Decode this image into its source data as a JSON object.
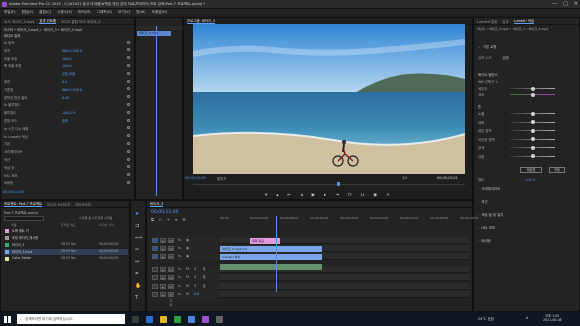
{
  "window": {
    "title": "Adobe Premiere Pro CC 2019 - C:\\#2021 광고 아이템\\#학습 영상 강의 자료\\프리미어 프로 강좌\\Part.7 프로젝트.prproj *",
    "controls": [
      "—",
      "□",
      "✕"
    ]
  },
  "menu": [
    "파일(F)",
    "편집(E)",
    "클립(C)",
    "시퀀스(S)",
    "마커(M)",
    "그래픽(G)",
    "보기(V)",
    "창(W)",
    "도움말(H)"
  ],
  "effect_controls": {
    "tabs": [
      "소스: 바이크_3.mp4",
      "효과 컨트롤",
      "오디오 클립 믹서: 바이크_3",
      "메타데이터"
    ],
    "header": "마스터 • 바이크_3.mp4  〉 바이크_3 • 바이크_3.mp4",
    "section_video": "비디오 효과",
    "rows": [
      {
        "label": "fx 동작",
        "value": ""
      },
      {
        "label": "위치",
        "value": "960.0   540.0"
      },
      {
        "label": "비율 조정",
        "value": "100.0"
      },
      {
        "label": "폭 비율 조정",
        "value": "100.0"
      },
      {
        "label": "",
        "value": "균일 비율"
      },
      {
        "label": "회전",
        "value": "0.0"
      },
      {
        "label": "기준점",
        "value": "960.0   540.0"
      },
      {
        "label": "깜박임 방지 필터",
        "value": "0.00"
      },
      {
        "label": "fx 불투명도",
        "value": ""
      },
      {
        "label": "불투명도",
        "value": "100.0 %"
      },
      {
        "label": "혼합 모드",
        "value": "표준"
      },
      {
        "label": "fx 시간 다시 매핑",
        "value": ""
      },
      {
        "label": "fx Lumetri 색상",
        "value": ""
      },
      {
        "label": "기본",
        "value": ""
      },
      {
        "label": "크리에이티브",
        "value": ""
      },
      {
        "label": "곡선",
        "value": ""
      },
      {
        "label": "색상 휠",
        "value": ""
      },
      {
        "label": "HSL 보조",
        "value": ""
      },
      {
        "label": "비네팅",
        "value": ""
      }
    ],
    "clip_label": "바이크_3.mp4",
    "timecode": "00;00;11;00"
  },
  "program": {
    "tab": "프로그램: 바이크_3",
    "timecode_left": "00;00;11;00",
    "fit": "맞추기",
    "quality": "1/2",
    "timecode_right": "00;00;25;01"
  },
  "project": {
    "tabs": [
      "프로젝트: Part.7 프로젝트",
      "미디어 브라우저",
      "라이브러리"
    ],
    "file": "Part.7 프로젝트.prproj",
    "count": "4 항목 중 1개 항목 선택됨",
    "columns": [
      "이름",
      "프레임 속도",
      "미디어 시작"
    ],
    "items": [
      {
        "name": "트랙 매트 키",
        "fps": "",
        "start": ""
      },
      {
        "name": "조정 레이어_재사용",
        "fps": "",
        "start": ""
      },
      {
        "name": "바이크_3",
        "fps": "29.97 fps",
        "start": "00;00;00;00"
      },
      {
        "name": "바이크_3.mp4",
        "fps": "29.97 fps",
        "start": "00;00;00;00"
      },
      {
        "name": "Color_Matte",
        "fps": "29.97 fps",
        "start": "00;00;00;00"
      }
    ]
  },
  "timeline": {
    "tab": "바이크_3",
    "timecode": "00;00;11;00",
    "ruler": [
      "00;00",
      "00;00;04;00",
      "00;00;08;00",
      "00;00;12;00",
      "00;00;16;00",
      "00;00;20;00",
      "00;00;24;00",
      "00;00;28;00",
      "00;00;32;00"
    ],
    "tracks": [
      "V3",
      "V2",
      "V1",
      "A1",
      "A2",
      "A3",
      "마스터"
    ],
    "master_value": "0.0",
    "clips": {
      "title": "제목 없음",
      "video1": "바이크_3.mp4 [V]",
      "video2": "Lumetri 색상"
    }
  },
  "lumetri": {
    "tabs": [
      "Lumetri 범위",
      "효과",
      "Lumetri 색상"
    ],
    "clip_header": "마스터 • 바이크_3.mp4  〉 바이크_3 • 바이크_3.mp4",
    "sections": [
      "기본 교정",
      "입력 LUT",
      "크리에이티브",
      "곡선",
      "색상 휠 및 일치",
      "HSL 보조",
      "비네팅"
    ],
    "lut_label": "입력 LUT",
    "lut_value": "없음",
    "white_balance_label": "화이트 밸런스",
    "wb_items": [
      "WB 선택기",
      "색온도",
      "색조"
    ],
    "tone_label": "톤",
    "tone_items": [
      "노출",
      "대비",
      "밝은 영역",
      "어두운 영역",
      "흰색",
      "검정"
    ],
    "reset_button": "재설정",
    "auto_button": "자동",
    "saturation": "채도",
    "saturation_value": "100.0"
  },
  "taskbar": {
    "search_placeholder": "검색하려면 여기에 입력하십시오.",
    "weather": "24°C 흐림",
    "ime": "A",
    "time": "오후 1:05",
    "date": "2021-06-08"
  },
  "colors": {
    "accent": "#2d8ceb",
    "clip_video": "#7aa5e8",
    "clip_title": "#e59adf",
    "keyframe_blue": "#5b9bff"
  }
}
